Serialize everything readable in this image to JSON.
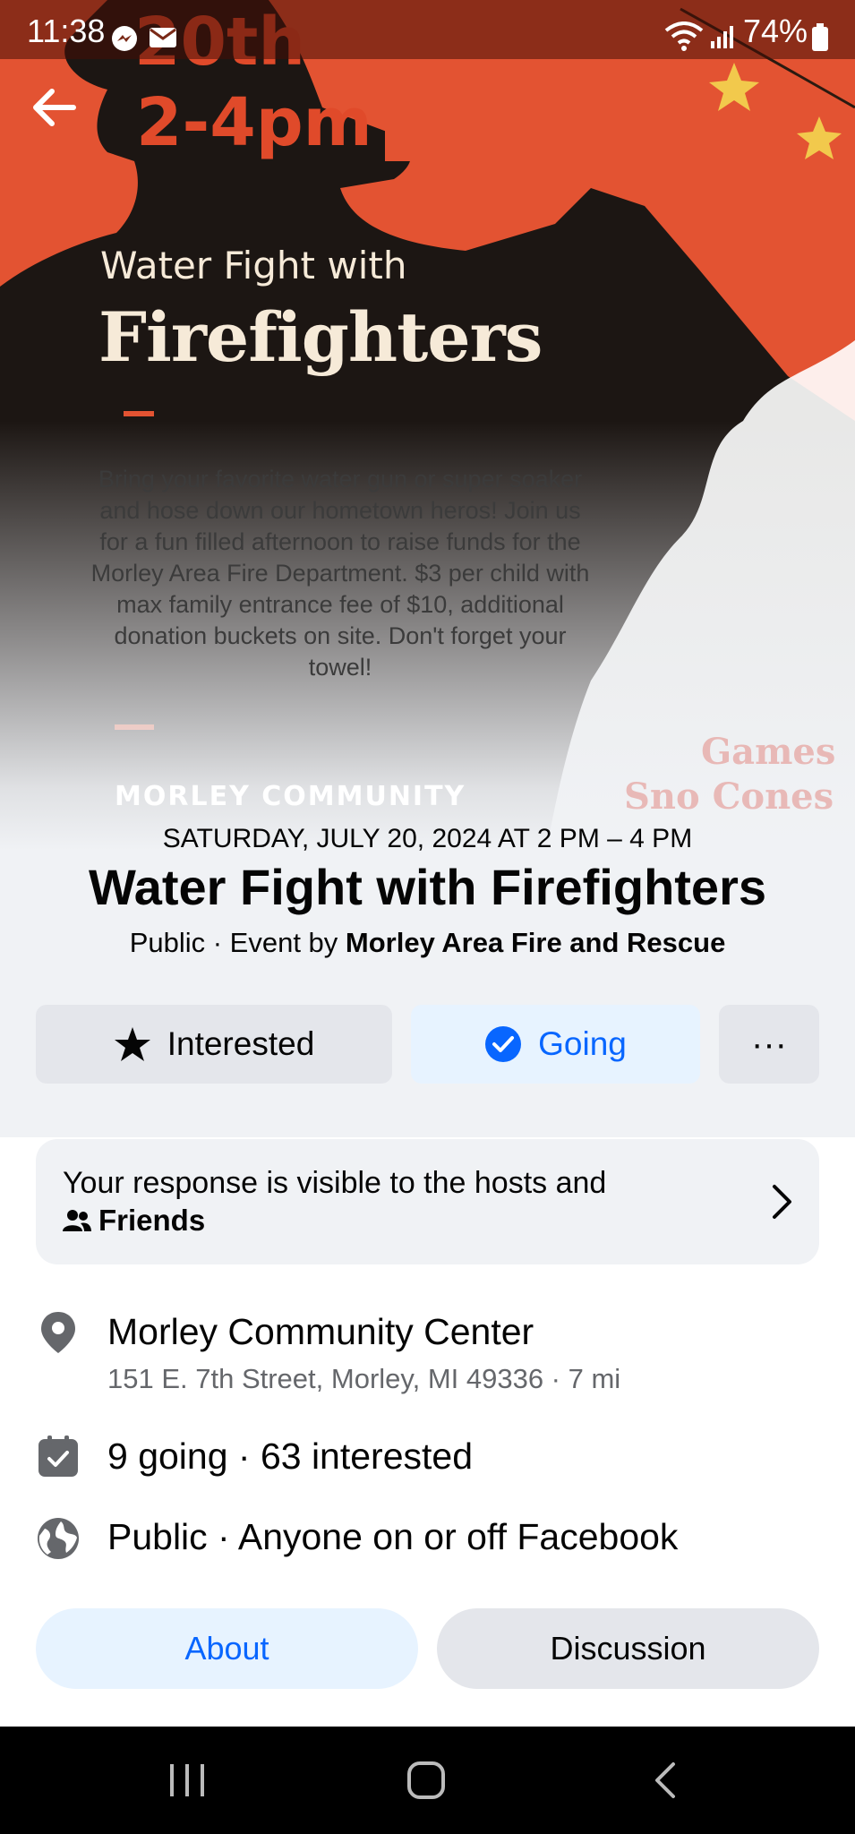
{
  "status_bar": {
    "time": "11:38",
    "battery": "74%"
  },
  "poster": {
    "date_fragment": "20th",
    "time": "2-4pm",
    "subtitle": "Water Fight with",
    "title": "Firefighters",
    "description": "Bring your favorite water gun or super soaker and hose down our hometown heros! Join us for a fun filled afternoon to raise funds for the Morley Area Fire Department. $3 per child with max family entrance fee of $10, additional donation buckets on site. Don't forget your towel!",
    "venue": "MORLEY COMMUNITY",
    "side_items": [
      "Games",
      "Sno Cones"
    ]
  },
  "event": {
    "date": "SATURDAY, JULY 20, 2024 AT 2 PM – 4 PM",
    "title": "Water Fight with Firefighters",
    "meta_prefix": "Public · Event by ",
    "host": "Morley Area Fire and Rescue"
  },
  "actions": {
    "interested": "Interested",
    "going": "Going",
    "more": "···"
  },
  "response_card": {
    "text": "Your response is visible to the hosts and",
    "audience": "Friends"
  },
  "details": {
    "location_name": "Morley Community Center",
    "location_address": "151 E. 7th Street, Morley, MI 49336 · 7 mi",
    "attendance": "9 going · 63 interested",
    "privacy": "Public · Anyone on or off Facebook"
  },
  "tabs": [
    {
      "label": "About"
    },
    {
      "label": "Discussion"
    }
  ],
  "colors": {
    "accent": "#0866ff",
    "accent_bg": "#e7f3ff",
    "button_bg": "#e4e6eb",
    "poster_orange": "#e35332"
  }
}
